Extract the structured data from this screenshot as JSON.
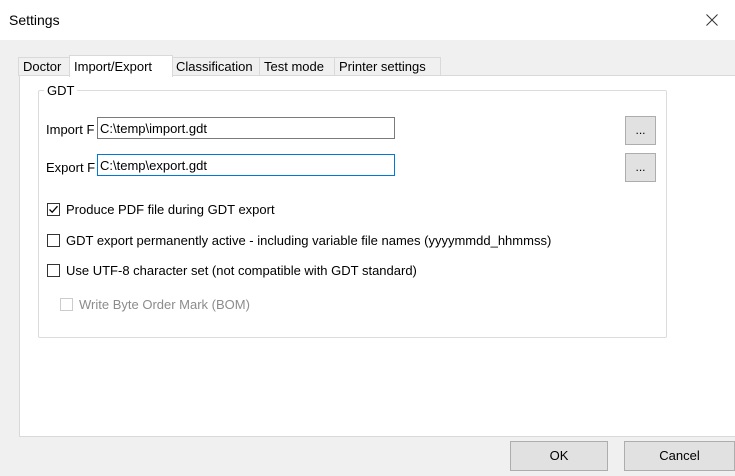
{
  "window": {
    "title": "Settings"
  },
  "tabs": [
    {
      "label": "Doctor"
    },
    {
      "label": "Import/Export"
    },
    {
      "label": "Classification"
    },
    {
      "label": "Test mode"
    },
    {
      "label": "Printer settings"
    }
  ],
  "active_tab": "Import/Export",
  "gdt": {
    "legend": "GDT",
    "import_label": "Import F",
    "import_value": "C:\\temp\\import.gdt",
    "export_label": "Export F",
    "export_value": "C:\\temp\\export.gdt",
    "browse_label": "...",
    "options": [
      {
        "label": "Produce PDF file during GDT export",
        "checked": true,
        "enabled": true
      },
      {
        "label": "GDT export permanently active - including variable file names (yyyymmdd_hhmmss)",
        "checked": false,
        "enabled": true
      },
      {
        "label": "Use UTF-8 character set (not compatible with GDT standard)",
        "checked": false,
        "enabled": true
      },
      {
        "label": "Write Byte Order Mark (BOM)",
        "checked": false,
        "enabled": false
      }
    ]
  },
  "buttons": {
    "ok": "OK",
    "cancel": "Cancel"
  },
  "icons": {
    "close": "close-icon",
    "checkmark": "checkmark-icon"
  },
  "colors": {
    "focus_border": "#0078d7",
    "panel_bg": "#ffffff",
    "window_bg": "#f0f0f0"
  }
}
